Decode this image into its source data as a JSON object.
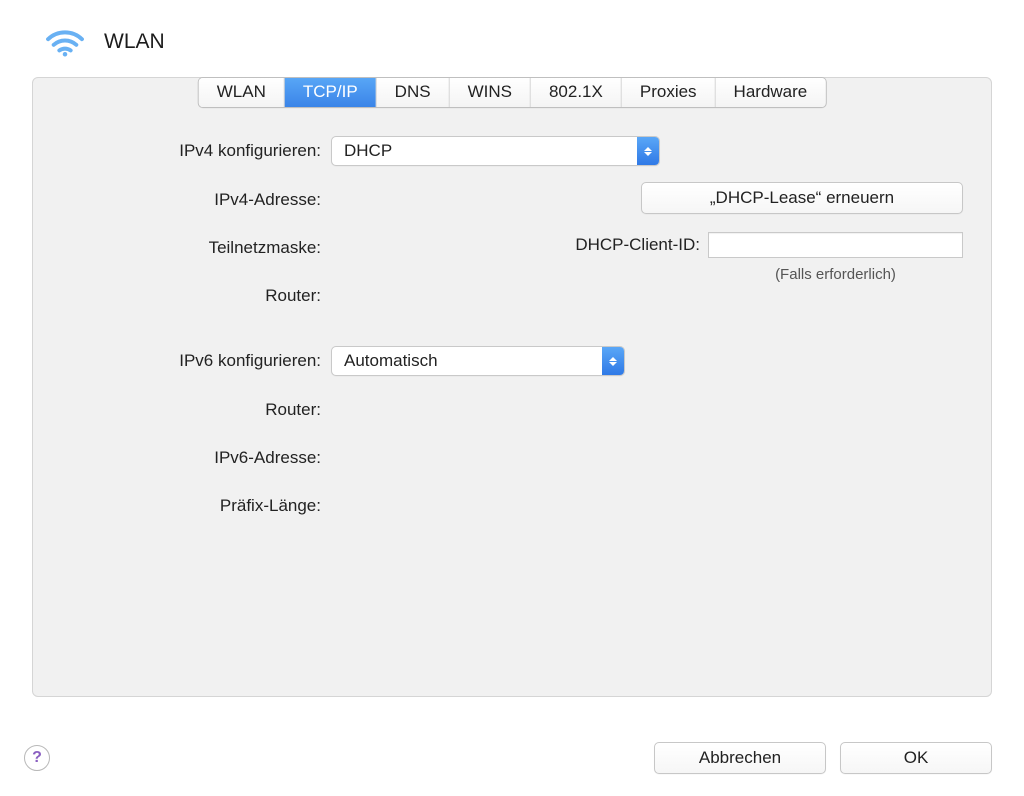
{
  "header": {
    "title": "WLAN"
  },
  "tabs": [
    "WLAN",
    "TCP/IP",
    "DNS",
    "WINS",
    "802.1X",
    "Proxies",
    "Hardware"
  ],
  "active_tab_index": 1,
  "form": {
    "ipv4_configure_label": "IPv4 konfigurieren:",
    "ipv4_configure_value": "DHCP",
    "ipv4_address_label": "IPv4-Adresse:",
    "subnet_label": "Teilnetzmaske:",
    "router_label": "Router:",
    "ipv6_configure_label": "IPv6 konfigurieren:",
    "ipv6_configure_value": "Automatisch",
    "router6_label": "Router:",
    "ipv6_address_label": "IPv6-Adresse:",
    "prefix_label": "Präfix-Länge:"
  },
  "dhcp": {
    "renew_button": "„DHCP-Lease“ erneuern",
    "client_id_label": "DHCP-Client-ID:",
    "client_id_value": "",
    "hint": "(Falls erforderlich)"
  },
  "buttons": {
    "help": "?",
    "cancel": "Abbrechen",
    "ok": "OK"
  }
}
